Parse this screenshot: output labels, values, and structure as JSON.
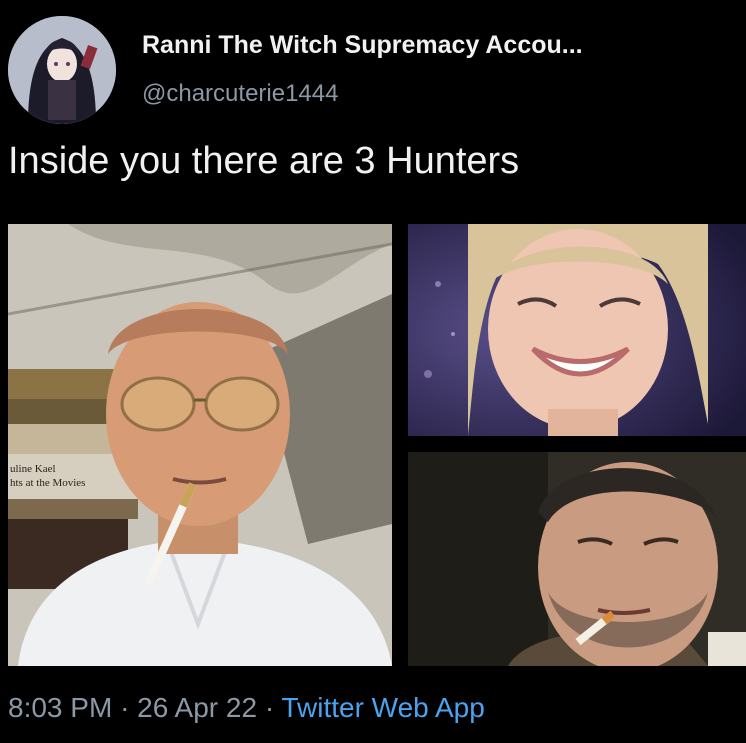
{
  "tweet": {
    "display_name": "Ranni The Witch Supremacy Accou...",
    "handle": "@charcuterie1444",
    "text": "Inside you there are 3 Hunters",
    "timestamp_time": "8:03 PM",
    "separator": "·",
    "timestamp_date": "26 Apr 22",
    "source": "Twitter Web App"
  },
  "photos": {
    "book_text_line1": "uline Kael",
    "book_text_line2": "hts at the Movies"
  },
  "colors": {
    "background": "#000000",
    "primary_text": "#e7e9ea",
    "secondary_text": "#8b98a5",
    "link": "#4aa3ee"
  }
}
